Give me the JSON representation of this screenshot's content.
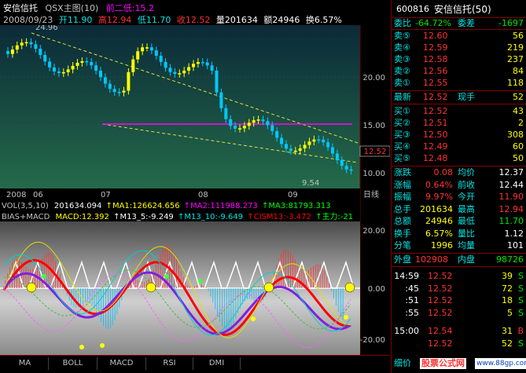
{
  "header": {
    "title": "安信信托",
    "indicator_title": "QSX主图(10)",
    "prev_high_label": "前二低:15.2",
    "date": "2008/09/23",
    "open": "开11.90",
    "high": "高12.94",
    "low": "低11.70",
    "close": "收12.52",
    "volume": "量201634",
    "amount": "额24946",
    "turnover": "换6.57%"
  },
  "price_axis": [
    "20.00",
    "15.00",
    "10.00"
  ],
  "price_markers": {
    "current_price": "12.52",
    "low_label": "9.54",
    "high_label": "24.96"
  },
  "time_axis": [
    "2008",
    "06",
    "07",
    "08",
    "09",
    "日线"
  ],
  "vol_line": {
    "label": "VOL(3,5,10)",
    "vol": "201634.094",
    "ma1": "MA1:126624.656",
    "ma2": "MA2:111988.273",
    "ma3": "MA3:81793.313"
  },
  "macd_line": {
    "label": "BIAS+MACD",
    "macd": "MACD:12.392",
    "m13_5": "M13_5:-9.249",
    "m13_10": "M13_10:-9.649",
    "cism": "CISM13:-3.472",
    "main": "主力:-21"
  },
  "macd_axis": [
    "20.00",
    "0.00",
    "-20.00"
  ],
  "bottom_tabs": [
    "MA",
    "BOLL",
    "MACD",
    "RSI",
    "DMI"
  ],
  "right_panel": {
    "code": "600816",
    "name": "安信信托(50)",
    "ratio_label": "委比",
    "ratio": "-64.72%",
    "diff_label": "委差",
    "diff": "-1697",
    "sells": [
      {
        "label": "卖⑤",
        "price": "12.60",
        "vol": "56"
      },
      {
        "label": "卖④",
        "price": "12.59",
        "vol": "219"
      },
      {
        "label": "卖③",
        "price": "12.58",
        "vol": "237"
      },
      {
        "label": "卖②",
        "price": "12.56",
        "vol": "84"
      },
      {
        "label": "卖①",
        "price": "12.55",
        "vol": "118"
      }
    ],
    "last_label": "最新",
    "last": "12.52",
    "cur_vol_label": "现手",
    "cur_vol": "52",
    "buys": [
      {
        "label": "买①",
        "price": "12.52",
        "vol": "43"
      },
      {
        "label": "买②",
        "price": "12.51",
        "vol": "2"
      },
      {
        "label": "买③",
        "price": "12.50",
        "vol": "308"
      },
      {
        "label": "买④",
        "price": "12.49",
        "vol": "60"
      },
      {
        "label": "买⑤",
        "price": "12.48",
        "vol": "50"
      }
    ],
    "stats": [
      {
        "l1": "涨跌",
        "v1": "0.08",
        "l2": "均价",
        "v2": "12.37"
      },
      {
        "l1": "涨幅",
        "v1": "0.64%",
        "l2": "前收",
        "v2": "12.44"
      },
      {
        "l1": "振幅",
        "v1": "9.97%",
        "l2": "今开",
        "v2": "11.90"
      },
      {
        "l1": "总手",
        "v1": "201634",
        "l2": "最高",
        "v2": "12.94"
      },
      {
        "l1": "总额",
        "v1": "24946",
        "l2": "最低",
        "v2": "11.70"
      },
      {
        "l1": "换手",
        "v1": "6.57%",
        "l2": "量比",
        "v2": "1.12"
      },
      {
        "l1": "分笔",
        "v1": "1996",
        "l2": "均量",
        "v2": "101"
      }
    ],
    "outer_label": "外盘",
    "outer": "102908",
    "inner_label": "内盘",
    "inner": "98726",
    "ticks": [
      {
        "time": "14:59",
        "price": "12.52",
        "vol": "39",
        "flag": "S"
      },
      {
        "time": ":45",
        "price": "12.52",
        "vol": "72",
        "flag": "S"
      },
      {
        "time": ":51",
        "price": "12.52",
        "vol": "18",
        "flag": "S"
      },
      {
        "time": ":55",
        "price": "12.52",
        "vol": "5",
        "flag": "S"
      },
      {
        "time": "15:00",
        "price": "12.54",
        "vol": "31",
        "flag": "B"
      },
      {
        "time": "",
        "price": "12.52",
        "vol": "52",
        "flag": "S"
      }
    ],
    "detail_label": "细价",
    "watermark": "股票公式网",
    "watermark_url": "www.88gp.com"
  }
}
